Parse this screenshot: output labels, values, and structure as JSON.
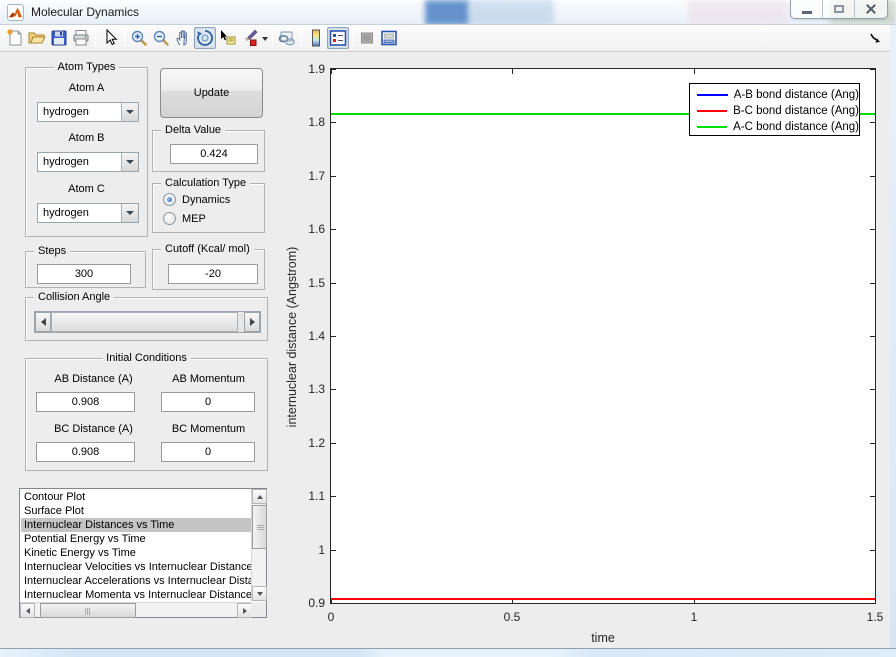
{
  "titlebar": {
    "title": "Molecular Dynamics",
    "buttons": [
      "minimize",
      "maximize",
      "close"
    ]
  },
  "toolbar": {
    "icons": [
      "new-file",
      "open-file",
      "save",
      "print",
      "pointer",
      "zoom-in",
      "zoom-out",
      "pan",
      "rotate-3d",
      "data-cursor",
      "brush",
      "brush-dropdown",
      "link-plot",
      "insert-colorbar",
      "insert-legend",
      "hide-plot-tools",
      "show-plot-tools",
      "dock-figure"
    ],
    "selected_icons": [
      "rotate-3d",
      "insert-legend"
    ]
  },
  "panels": {
    "atom_types": {
      "title": "Atom Types",
      "fields": [
        {
          "label": "Atom A",
          "value": "hydrogen"
        },
        {
          "label": "Atom B",
          "value": "hydrogen"
        },
        {
          "label": "Atom C",
          "value": "hydrogen"
        }
      ]
    },
    "update_button_label": "Update",
    "delta_value": {
      "title": "Delta Value",
      "value": "0.424"
    },
    "calculation_type": {
      "title": "Calculation Type",
      "options": [
        {
          "label": "Dynamics",
          "selected": true
        },
        {
          "label": "MEP",
          "selected": false
        }
      ]
    },
    "steps": {
      "title": "Steps",
      "value": "300"
    },
    "cutoff": {
      "title": "Cutoff (Kcal/ mol)",
      "value": "-20"
    },
    "collision_angle": {
      "title": "Collision Angle"
    },
    "initial_conditions": {
      "title": "Initial Conditions",
      "fields": [
        {
          "label": "AB Distance (A)",
          "value": "0.908"
        },
        {
          "label": "AB Momentum",
          "value": "0"
        },
        {
          "label": "BC Distance (A)",
          "value": "0.908"
        },
        {
          "label": "BC Momentum",
          "value": "0"
        }
      ]
    },
    "plot_list": {
      "items": [
        "Contour Plot",
        "Surface Plot",
        "Internuclear Distances vs Time",
        "Potential Energy vs Time",
        "Kinetic Energy vs Time",
        "Internuclear Velocities vs Internuclear Distance",
        "Internuclear Accelerations vs Internuclear Dista",
        "Internuclear Momenta vs Internuclear Distance"
      ],
      "selected_index": 2
    }
  },
  "chart_data": {
    "type": "line",
    "title": "",
    "xlabel": "time",
    "ylabel": "internuclear distance (Angstrom)",
    "xlim": [
      0,
      1.5
    ],
    "ylim": [
      0.9,
      1.9
    ],
    "xticks": [
      0,
      0.5,
      1,
      1.5
    ],
    "xtick_labels": [
      "0",
      "0.5",
      "1",
      "1.5"
    ],
    "yticks": [
      0.9,
      1.0,
      1.1,
      1.2,
      1.3,
      1.4,
      1.5,
      1.6,
      1.7,
      1.8,
      1.9
    ],
    "ytick_labels": [
      "0.9",
      "1",
      "1.1",
      "1.2",
      "1.3",
      "1.4",
      "1.5",
      "1.6",
      "1.7",
      "1.8",
      "1.9"
    ],
    "grid": false,
    "legend_position": "top-right",
    "x": [
      0,
      1.5
    ],
    "series": [
      {
        "name": "A-B bond distance (Ang)",
        "color": "#0000ff",
        "values": [
          0.908,
          0.908
        ]
      },
      {
        "name": "B-C bond distance (Ang)",
        "color": "#ff0000",
        "values": [
          0.908,
          0.908
        ]
      },
      {
        "name": "A-C bond distance (Ang)",
        "color": "#00dd00",
        "values": [
          1.816,
          1.816
        ]
      }
    ]
  }
}
